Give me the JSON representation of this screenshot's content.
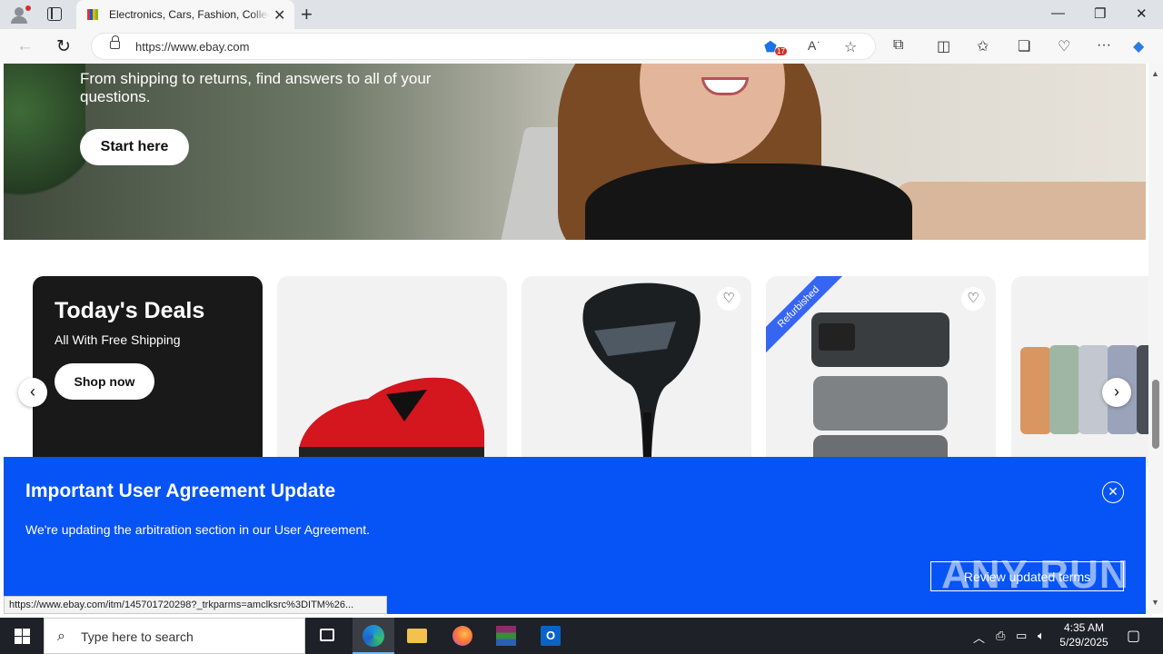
{
  "browser": {
    "tab_title": "Electronics, Cars, Fashion, Collectibles & More | eBay",
    "url": "https://www.ebay.com",
    "shopping_badge": "17"
  },
  "hero": {
    "text": "From shipping to returns, find answers to all of your questions.",
    "button": "Start here"
  },
  "deals": {
    "title": "Today's Deals",
    "subtitle": "All With Free Shipping",
    "button": "Shop now",
    "ribbon": "Refurbished"
  },
  "banner": {
    "title": "Important User Agreement Update",
    "text": "We're updating the arbitration section in our User Agreement.",
    "button": "Review updated terms"
  },
  "status_url": "https://www.ebay.com/itm/145701720298?_trkparms=amclksrc%3DITM%26...",
  "watermark": "ANY RUN",
  "taskbar": {
    "search_placeholder": "Type here to search",
    "time": "4:35 AM",
    "date": "5/29/2025"
  },
  "colors": {
    "banner_blue": "#0654f5",
    "ribbon_blue": "#3665f3",
    "deals_card": "#191919"
  }
}
